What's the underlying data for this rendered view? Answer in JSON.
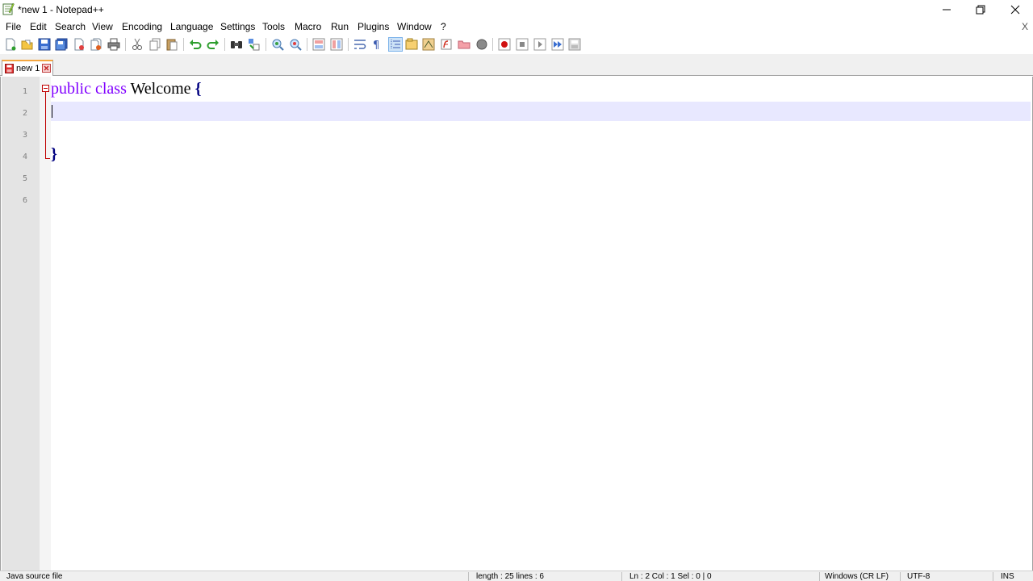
{
  "window": {
    "title": "*new 1 - Notepad++",
    "app_icon": "notepad-plus-plus-icon",
    "controls": [
      "minimize-icon",
      "restore-icon",
      "close-icon"
    ]
  },
  "menu": {
    "items": [
      "File",
      "Edit",
      "Search",
      "View",
      "Encoding",
      "Language",
      "Settings",
      "Tools",
      "Macro",
      "Run",
      "Plugins",
      "Window",
      "?"
    ],
    "close_label": "X"
  },
  "toolbar": {
    "buttons": [
      "new-file-icon",
      "open-file-icon",
      "save-icon",
      "save-all-icon",
      "close-icon",
      "close-all-icon",
      "print-icon",
      "cut-icon",
      "copy-icon",
      "paste-icon",
      "undo-icon",
      "redo-icon",
      "find-icon",
      "replace-icon",
      "zoom-in-icon",
      "zoom-out-icon",
      "sync-vertical-icon",
      "sync-horizontal-icon",
      "word-wrap-icon",
      "show-all-characters-icon",
      "indent-guide-icon",
      "user-defined-language-icon",
      "document-map-icon",
      "function-list-icon",
      "folder-as-workspace-icon",
      "monitoring-icon",
      "record-macro-icon",
      "stop-recording-icon",
      "play-macro-icon",
      "run-macro-multiple-icon",
      "save-macro-icon"
    ]
  },
  "tabs": [
    {
      "label": "new 1",
      "icon": "unsaved-file-icon",
      "active": true
    }
  ],
  "editor": {
    "line_numbers": [
      "1",
      "2",
      "3",
      "4",
      "5",
      "6"
    ],
    "current_line": 2,
    "code": {
      "line1": {
        "kw1": "public",
        "kw2": "class",
        "name": "Welcome",
        "brace": "{"
      },
      "line4": {
        "brace": "}"
      }
    },
    "colors": {
      "keyword": "#8000ff",
      "brace": "#000080",
      "current_line_bg": "#e8e8ff",
      "fold_marker": "#c00000"
    }
  },
  "statusbar": {
    "file_type": "Java source file",
    "length_lines": "length : 25    lines : 6",
    "position": "Ln : 2    Col : 1    Sel : 0 | 0",
    "eol": "Windows (CR LF)",
    "encoding": "UTF-8",
    "mode": "INS"
  }
}
